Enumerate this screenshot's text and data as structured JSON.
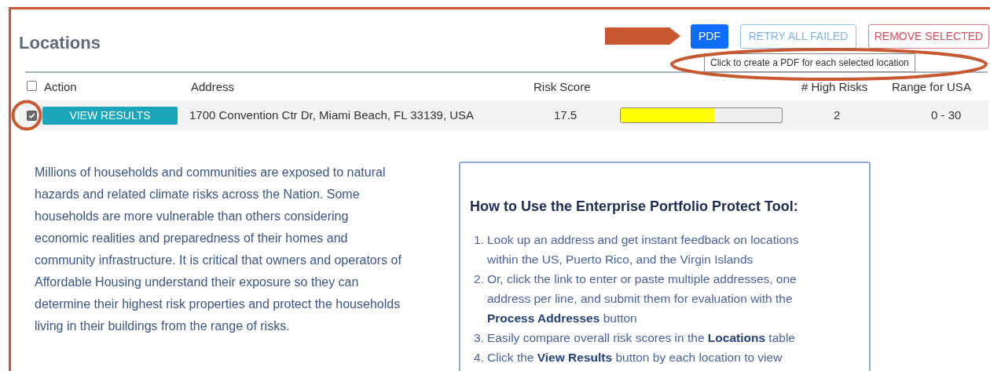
{
  "title": "Locations",
  "buttons": [
    {
      "kind": "primary",
      "label": "PDF"
    },
    {
      "kind": "outline-info",
      "label": "RETRY ALL FAILED"
    },
    {
      "kind": "outline-danger",
      "label": "REMOVE SELECTED"
    }
  ],
  "tooltip": "Click to create a PDF for each selected location",
  "table": {
    "select_all_checked": false,
    "columns": [
      "Action",
      "Address",
      "Risk Score",
      "# High Risks",
      "Range for USA"
    ],
    "rows": [
      {
        "checked": true,
        "action": "VIEW RESULTS",
        "address": "1700 Convention Ctr Dr, Miami Beach, FL 33139, USA",
        "risk_score": "17.5",
        "level": 0.58,
        "high_risks": "2",
        "range": "0 - 30"
      }
    ]
  },
  "intro": "Millions of households and communities are exposed to natural hazards and related climate risks across the Nation. Some households are more vulnerable than others considering economic realities and preparedness of their homes and community infrastructure. It is critical that owners and operators of Affordable Housing understand their exposure so they can determine their highest risk properties and protect the households living in their buildings from the range of risks.",
  "how_to": {
    "heading": "How to Use the Enterprise Portfolio Protect Tool:",
    "steps": [
      {
        "number": "1.",
        "text": "Look up an address and get instant feedback on locations within the US, Puerto Rico, and the Virgin Islands"
      },
      {
        "number": "2.",
        "text": "Or, click the link to enter or paste multiple addresses, one address per line, and submit them for evaluation with the **Process Addresses** button"
      },
      {
        "number": "3.",
        "text": "Easily compare overall risk scores in the **Locations** table"
      },
      {
        "number": "4.",
        "text": "Click the **View Results** button by each location to view"
      }
    ]
  },
  "annotations": [
    {
      "kind": "arrow"
    },
    {
      "kind": "ellipse"
    },
    {
      "kind": "circle"
    }
  ]
}
